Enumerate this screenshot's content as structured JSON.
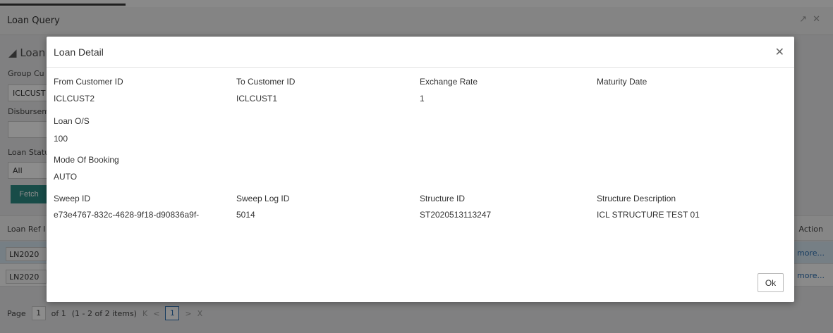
{
  "window": {
    "title": "Loan Query",
    "controls": [
      "minimize-icon",
      "close-icon"
    ]
  },
  "background": {
    "section_title": "Loan",
    "group_label": "Group Cu",
    "group_value": "ICLCUST",
    "disbursement_label": "Disbursem",
    "loan_status_label": "Loan Statu",
    "loan_status_value": "All",
    "fetch_label": "Fetch",
    "table_headers": {
      "loan_ref": "Loan Ref I",
      "action": "Action"
    },
    "rows": [
      {
        "loan_ref": "LN2020",
        "action": "more..."
      },
      {
        "loan_ref": "LN2020",
        "action": "more..."
      }
    ],
    "pager": {
      "page_label": "Page",
      "page_value": "1",
      "of_text": "of 1",
      "items_text": "(1 - 2 of 2 items)",
      "first": "K",
      "prev": "<",
      "current": "1",
      "next": ">",
      "last": "X"
    }
  },
  "modal": {
    "title": "Loan Detail",
    "close_icon": "close-icon",
    "fields": {
      "from_customer_id": {
        "label": "From Customer ID",
        "value": "ICLCUST2"
      },
      "to_customer_id": {
        "label": "To Customer ID",
        "value": "ICLCUST1"
      },
      "exchange_rate": {
        "label": "Exchange Rate",
        "value": "1"
      },
      "maturity_date": {
        "label": "Maturity Date",
        "value": ""
      },
      "loan_os": {
        "label": "Loan O/S",
        "value": "100"
      },
      "mode_of_booking": {
        "label": "Mode Of Booking",
        "value": "AUTO"
      },
      "sweep_id": {
        "label": "Sweep ID",
        "value": "e73e4767-832c-4628-9f18-d90836a9f-"
      },
      "sweep_log_id": {
        "label": "Sweep Log ID",
        "value": "5014"
      },
      "structure_id": {
        "label": "Structure ID",
        "value": "ST2020513113247"
      },
      "structure_description": {
        "label": "Structure Description",
        "value": "ICL STRUCTURE TEST 01"
      }
    },
    "ok_label": "Ok"
  },
  "colors": {
    "fetch_button": "#2d8a84",
    "selected_row": "#d8e8f3",
    "link": "#2a6db0"
  }
}
